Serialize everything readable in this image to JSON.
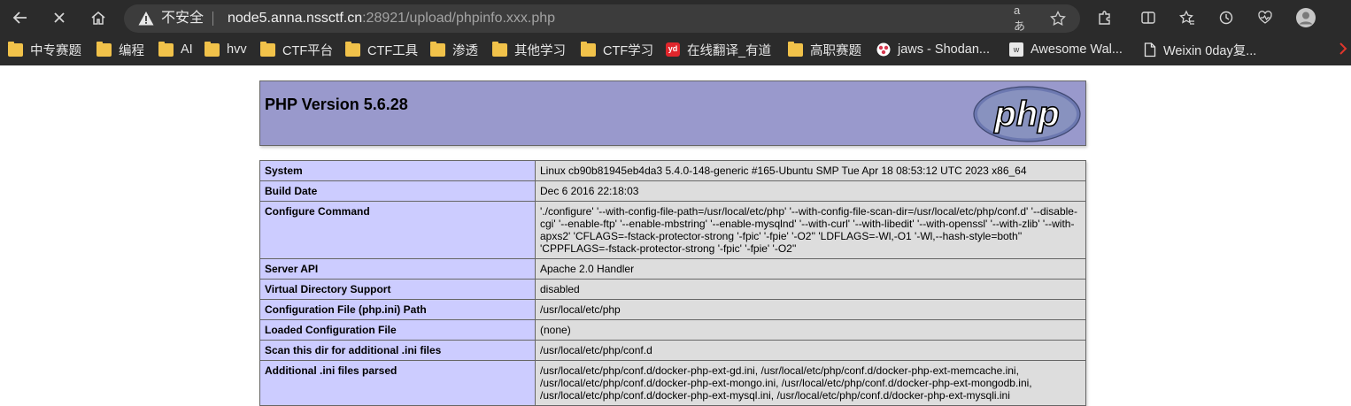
{
  "browser": {
    "security_label": "不安全",
    "url_host": "node5.anna.nssctf.cn",
    "url_rest": ":28921/upload/phpinfo.xxx.php",
    "read_aloud_glyph": "aあ",
    "accent": "#2b2b2b"
  },
  "bookmarks": [
    {
      "label": "中专赛题",
      "icon": "folder-icon"
    },
    {
      "label": "编程",
      "icon": "folder-icon"
    },
    {
      "label": "AI",
      "icon": "folder-icon"
    },
    {
      "label": "hvv",
      "icon": "folder-icon"
    },
    {
      "label": "CTF平台",
      "icon": "folder-icon"
    },
    {
      "label": "CTF工具",
      "icon": "folder-icon"
    },
    {
      "label": "渗透",
      "icon": "folder-icon"
    },
    {
      "label": "其他学习",
      "icon": "folder-icon"
    },
    {
      "label": "CTF学习",
      "icon": "folder-icon"
    },
    {
      "label": "在线翻译_有道",
      "icon": "youdao-icon"
    },
    {
      "label": "高职赛题",
      "icon": "folder-icon"
    },
    {
      "label": "jaws - Shodan...",
      "icon": "shodan-icon"
    },
    {
      "label": "Awesome Wal...",
      "icon": "awesome-icon"
    },
    {
      "label": "Weixin 0day复...",
      "icon": "page-icon"
    }
  ],
  "phpinfo": {
    "title": "PHP Version 5.6.28",
    "logo_text": "php",
    "rows": [
      {
        "key": "System",
        "value": "Linux cb90b81945eb4da3 5.4.0-148-generic #165-Ubuntu SMP Tue Apr 18 08:53:12 UTC 2023 x86_64"
      },
      {
        "key": "Build Date",
        "value": "Dec 6 2016 22:18:03"
      },
      {
        "key": "Configure Command",
        "value": "'./configure' '--with-config-file-path=/usr/local/etc/php' '--with-config-file-scan-dir=/usr/local/etc/php/conf.d' '--disable-cgi' '--enable-ftp' '--enable-mbstring' '--enable-mysqlnd' '--with-curl' '--with-libedit' '--with-openssl' '--with-zlib' '--with-apxs2' 'CFLAGS=-fstack-protector-strong '-fpic' '-fpie' '-O2'' 'LDFLAGS=-Wl,-O1 '-Wl,--hash-style=both'' 'CPPFLAGS=-fstack-protector-strong '-fpic' '-fpie' '-O2''"
      },
      {
        "key": "Server API",
        "value": "Apache 2.0 Handler"
      },
      {
        "key": "Virtual Directory Support",
        "value": "disabled"
      },
      {
        "key": "Configuration File (php.ini) Path",
        "value": "/usr/local/etc/php"
      },
      {
        "key": "Loaded Configuration File",
        "value": "(none)"
      },
      {
        "key": "Scan this dir for additional .ini files",
        "value": "/usr/local/etc/php/conf.d"
      },
      {
        "key": "Additional .ini files parsed",
        "value": "/usr/local/etc/php/conf.d/docker-php-ext-gd.ini, /usr/local/etc/php/conf.d/docker-php-ext-memcache.ini, /usr/local/etc/php/conf.d/docker-php-ext-mongo.ini, /usr/local/etc/php/conf.d/docker-php-ext-mongodb.ini, /usr/local/etc/php/conf.d/docker-php-ext-mysql.ini, /usr/local/etc/php/conf.d/docker-php-ext-mysqli.ini"
      }
    ]
  }
}
